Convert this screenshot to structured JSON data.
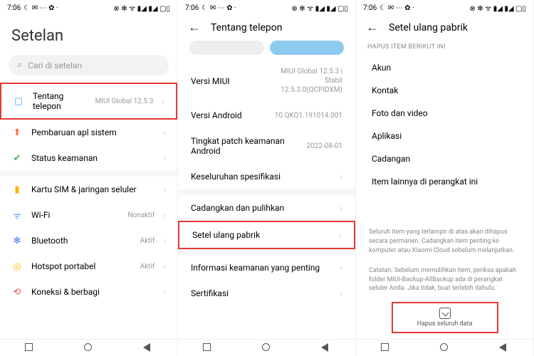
{
  "status": {
    "time": "7:06",
    "icons_left": "☾ ✉ ⋯ ✿ ·",
    "icons_right": "⊗ ✻ ᯤ ▮◢ ▮◢ ▢▯"
  },
  "p1": {
    "title": "Setelan",
    "search_placeholder": "Cari di setelan",
    "rows": [
      {
        "icon": "▢",
        "cls": "ic-phone",
        "label": "Tentang telepon",
        "value": "MIUI Global 12.5.3",
        "hl": true
      },
      {
        "icon": "⬆",
        "cls": "ic-up",
        "label": "Pembaruan apl sistem",
        "value": ""
      },
      {
        "icon": "✔",
        "cls": "ic-shield",
        "label": "Status keamanan",
        "value": ""
      }
    ],
    "rows2": [
      {
        "icon": "▮",
        "cls": "ic-sim",
        "label": "Kartu SIM & jaringan seluler",
        "value": ""
      },
      {
        "icon": "ᯤ",
        "cls": "ic-wifi",
        "label": "Wi-Fi",
        "value": "Nonaktif"
      },
      {
        "icon": "✻",
        "cls": "ic-bt",
        "label": "Bluetooth",
        "value": "Aktif"
      },
      {
        "icon": "◎",
        "cls": "ic-hot",
        "label": "Hotspot portabel",
        "value": "Aktif"
      },
      {
        "icon": "⟲",
        "cls": "ic-link",
        "label": "Koneksi & berbagi",
        "value": ""
      }
    ]
  },
  "p2": {
    "header": "Tentang telepon",
    "rows": [
      {
        "label": "Versi MIUI",
        "value": "MIUI Global 12.5.3 | Stabil\n12.5.3.0(QCPIDXM)"
      },
      {
        "label": "Versi Android",
        "value": "10 QKQ1.191014.001"
      },
      {
        "label": "Tingkat patch keamanan Android",
        "value": "2022-08-01"
      },
      {
        "label": "Keseluruhan spesifikasi",
        "value": "",
        "chev": true
      }
    ],
    "rows2": [
      {
        "label": "Cadangkan dan pulihkan",
        "value": "",
        "chev": true
      },
      {
        "label": "Setel ulang pabrik",
        "value": "",
        "chev": true,
        "hl": true
      }
    ],
    "rows3": [
      {
        "label": "Informasi keamanan yang penting",
        "value": "",
        "chev": true
      },
      {
        "label": "Sertifikasi",
        "value": "",
        "chev": true
      }
    ]
  },
  "p3": {
    "header": "Setel ulang pabrik",
    "sub": "HAPUS ITEM BERIKUT INI",
    "items": [
      "Akun",
      "Kontak",
      "Foto dan video",
      "Aplikasi",
      "Cadangan",
      "Item lainnya di perangkat ini"
    ],
    "note1": "Seluruh item yang terlampir di atas akan dihapus secara permanen. Cadangkan item penting ke komputer atau Xiaomi Cloud sebelum melanjutkan.",
    "note2": "Catatan: Sebelum memulihkan item, periksa apakah folder MIUI-Backup-AllBackup ada di perangkat seluler Anda. Jika tidak, buat terlebih dahulu.",
    "erase": "Hapus seluruh data"
  }
}
